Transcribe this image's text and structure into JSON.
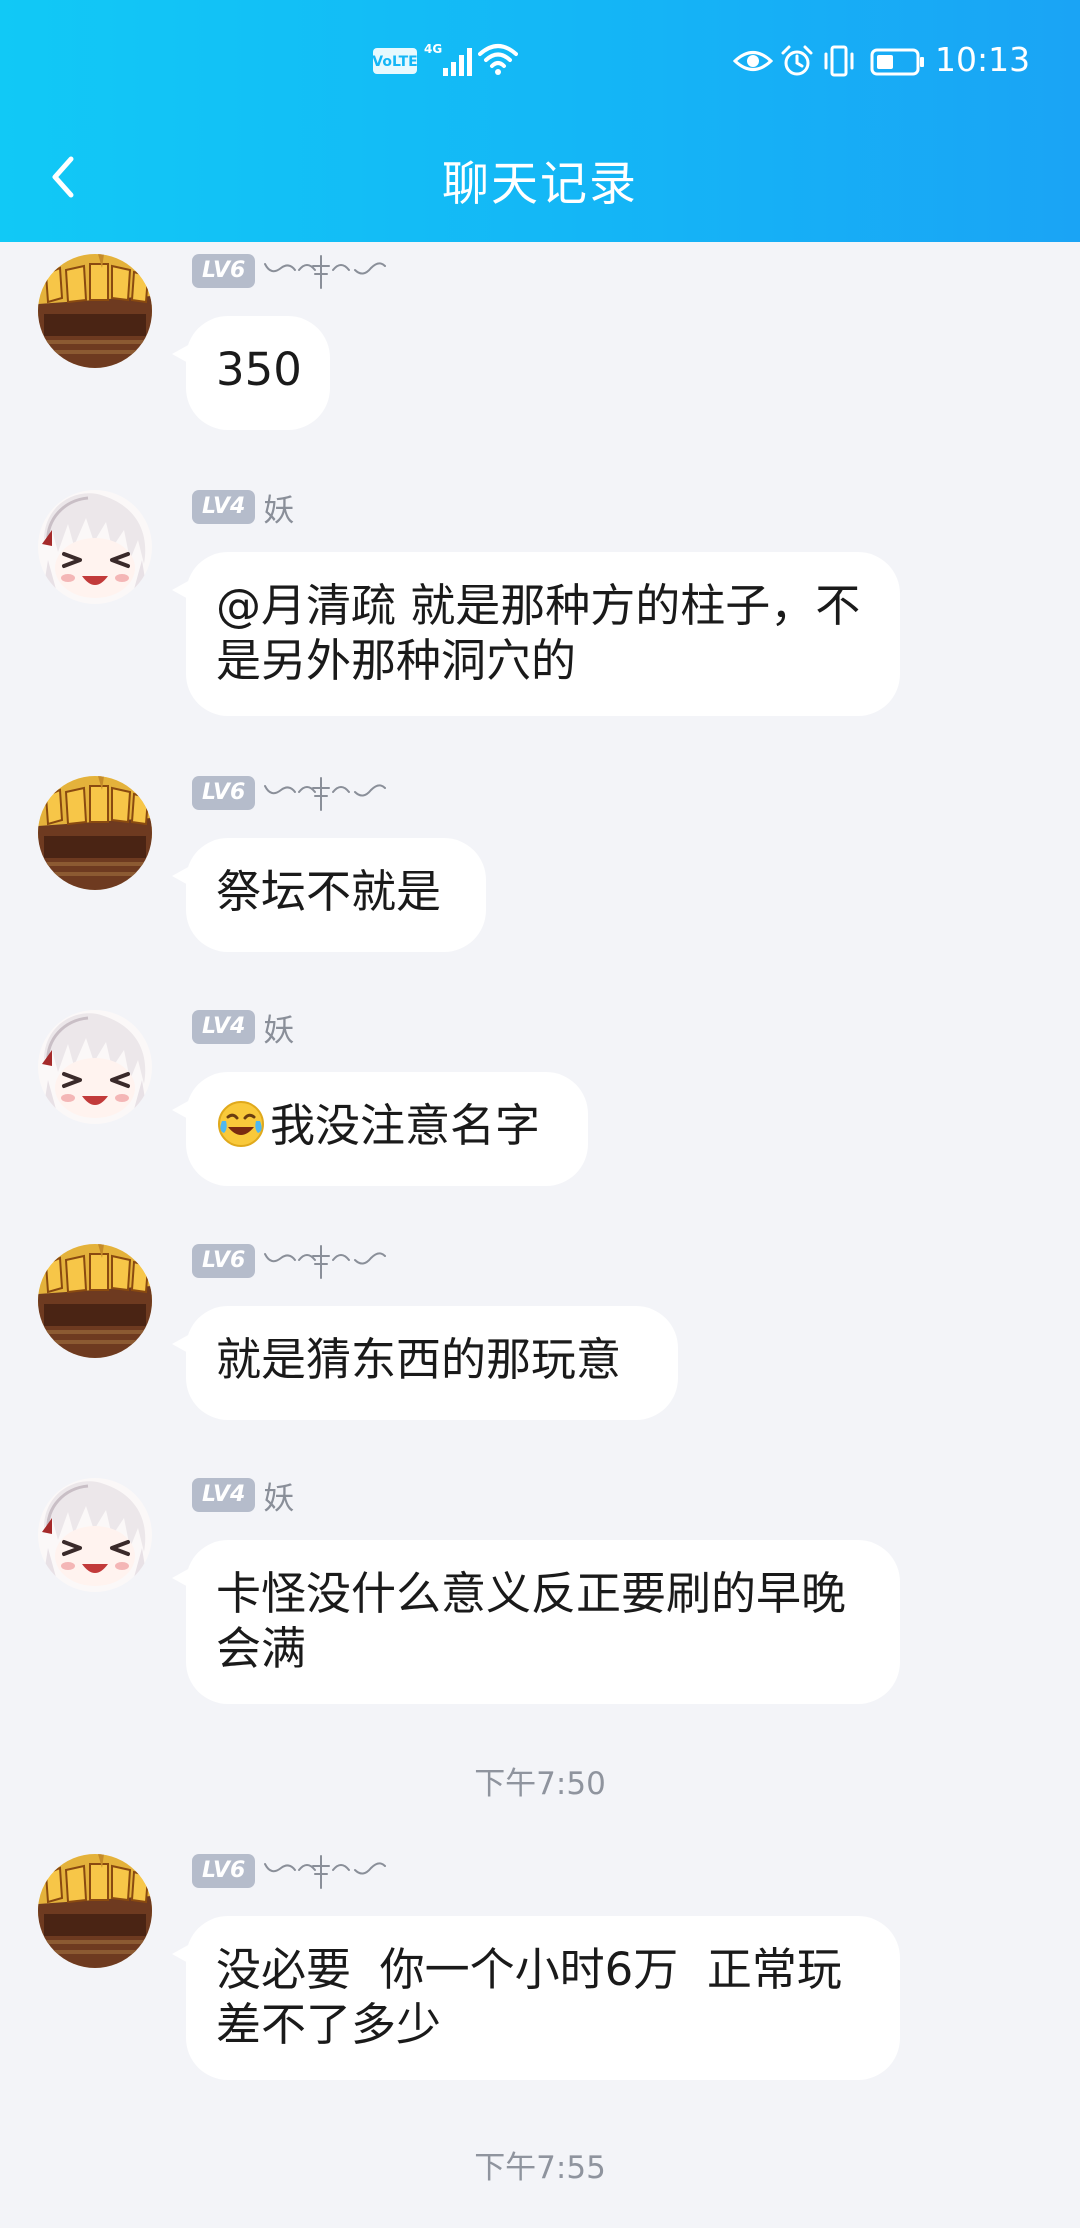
{
  "status_bar": {
    "network_badge": "VoLTE",
    "network_type": "4G",
    "time": "10:13"
  },
  "header": {
    "title": "聊天记录"
  },
  "messages": [
    {
      "type": "message",
      "avatar": "gold-logo-avatar",
      "level": "LV6",
      "nickname": "",
      "text": "350"
    },
    {
      "type": "message",
      "avatar": "anime-girl-avatar",
      "level": "LV4",
      "nickname": "妖",
      "text": "@月清疏 就是那种方的柱子，不是另外那种洞穴的"
    },
    {
      "type": "message",
      "avatar": "gold-logo-avatar",
      "level": "LV6",
      "nickname": "",
      "text": "祭坛不就是"
    },
    {
      "type": "message",
      "avatar": "anime-girl-avatar",
      "level": "LV4",
      "nickname": "妖",
      "emoji": "laughing-tears-emoji",
      "text": "我没注意名字"
    },
    {
      "type": "message",
      "avatar": "gold-logo-avatar",
      "level": "LV6",
      "nickname": "",
      "text": "就是猜东西的那玩意"
    },
    {
      "type": "message",
      "avatar": "anime-girl-avatar",
      "level": "LV4",
      "nickname": "妖",
      "text": "卡怪没什么意义反正要刷的早晚会满"
    },
    {
      "type": "timestamp",
      "text": "下午7:50"
    },
    {
      "type": "message",
      "avatar": "gold-logo-avatar",
      "level": "LV6",
      "nickname": "",
      "text": "没必要  你一个小时6万  正常玩差不了多少"
    },
    {
      "type": "timestamp",
      "text": "下午7:55"
    }
  ],
  "colors": {
    "header_gradient_start": "#11c9f6",
    "header_gradient_end": "#1aa4f5",
    "background": "#f3f4f8",
    "bubble": "#ffffff",
    "level_badge": "#b5bccb"
  }
}
